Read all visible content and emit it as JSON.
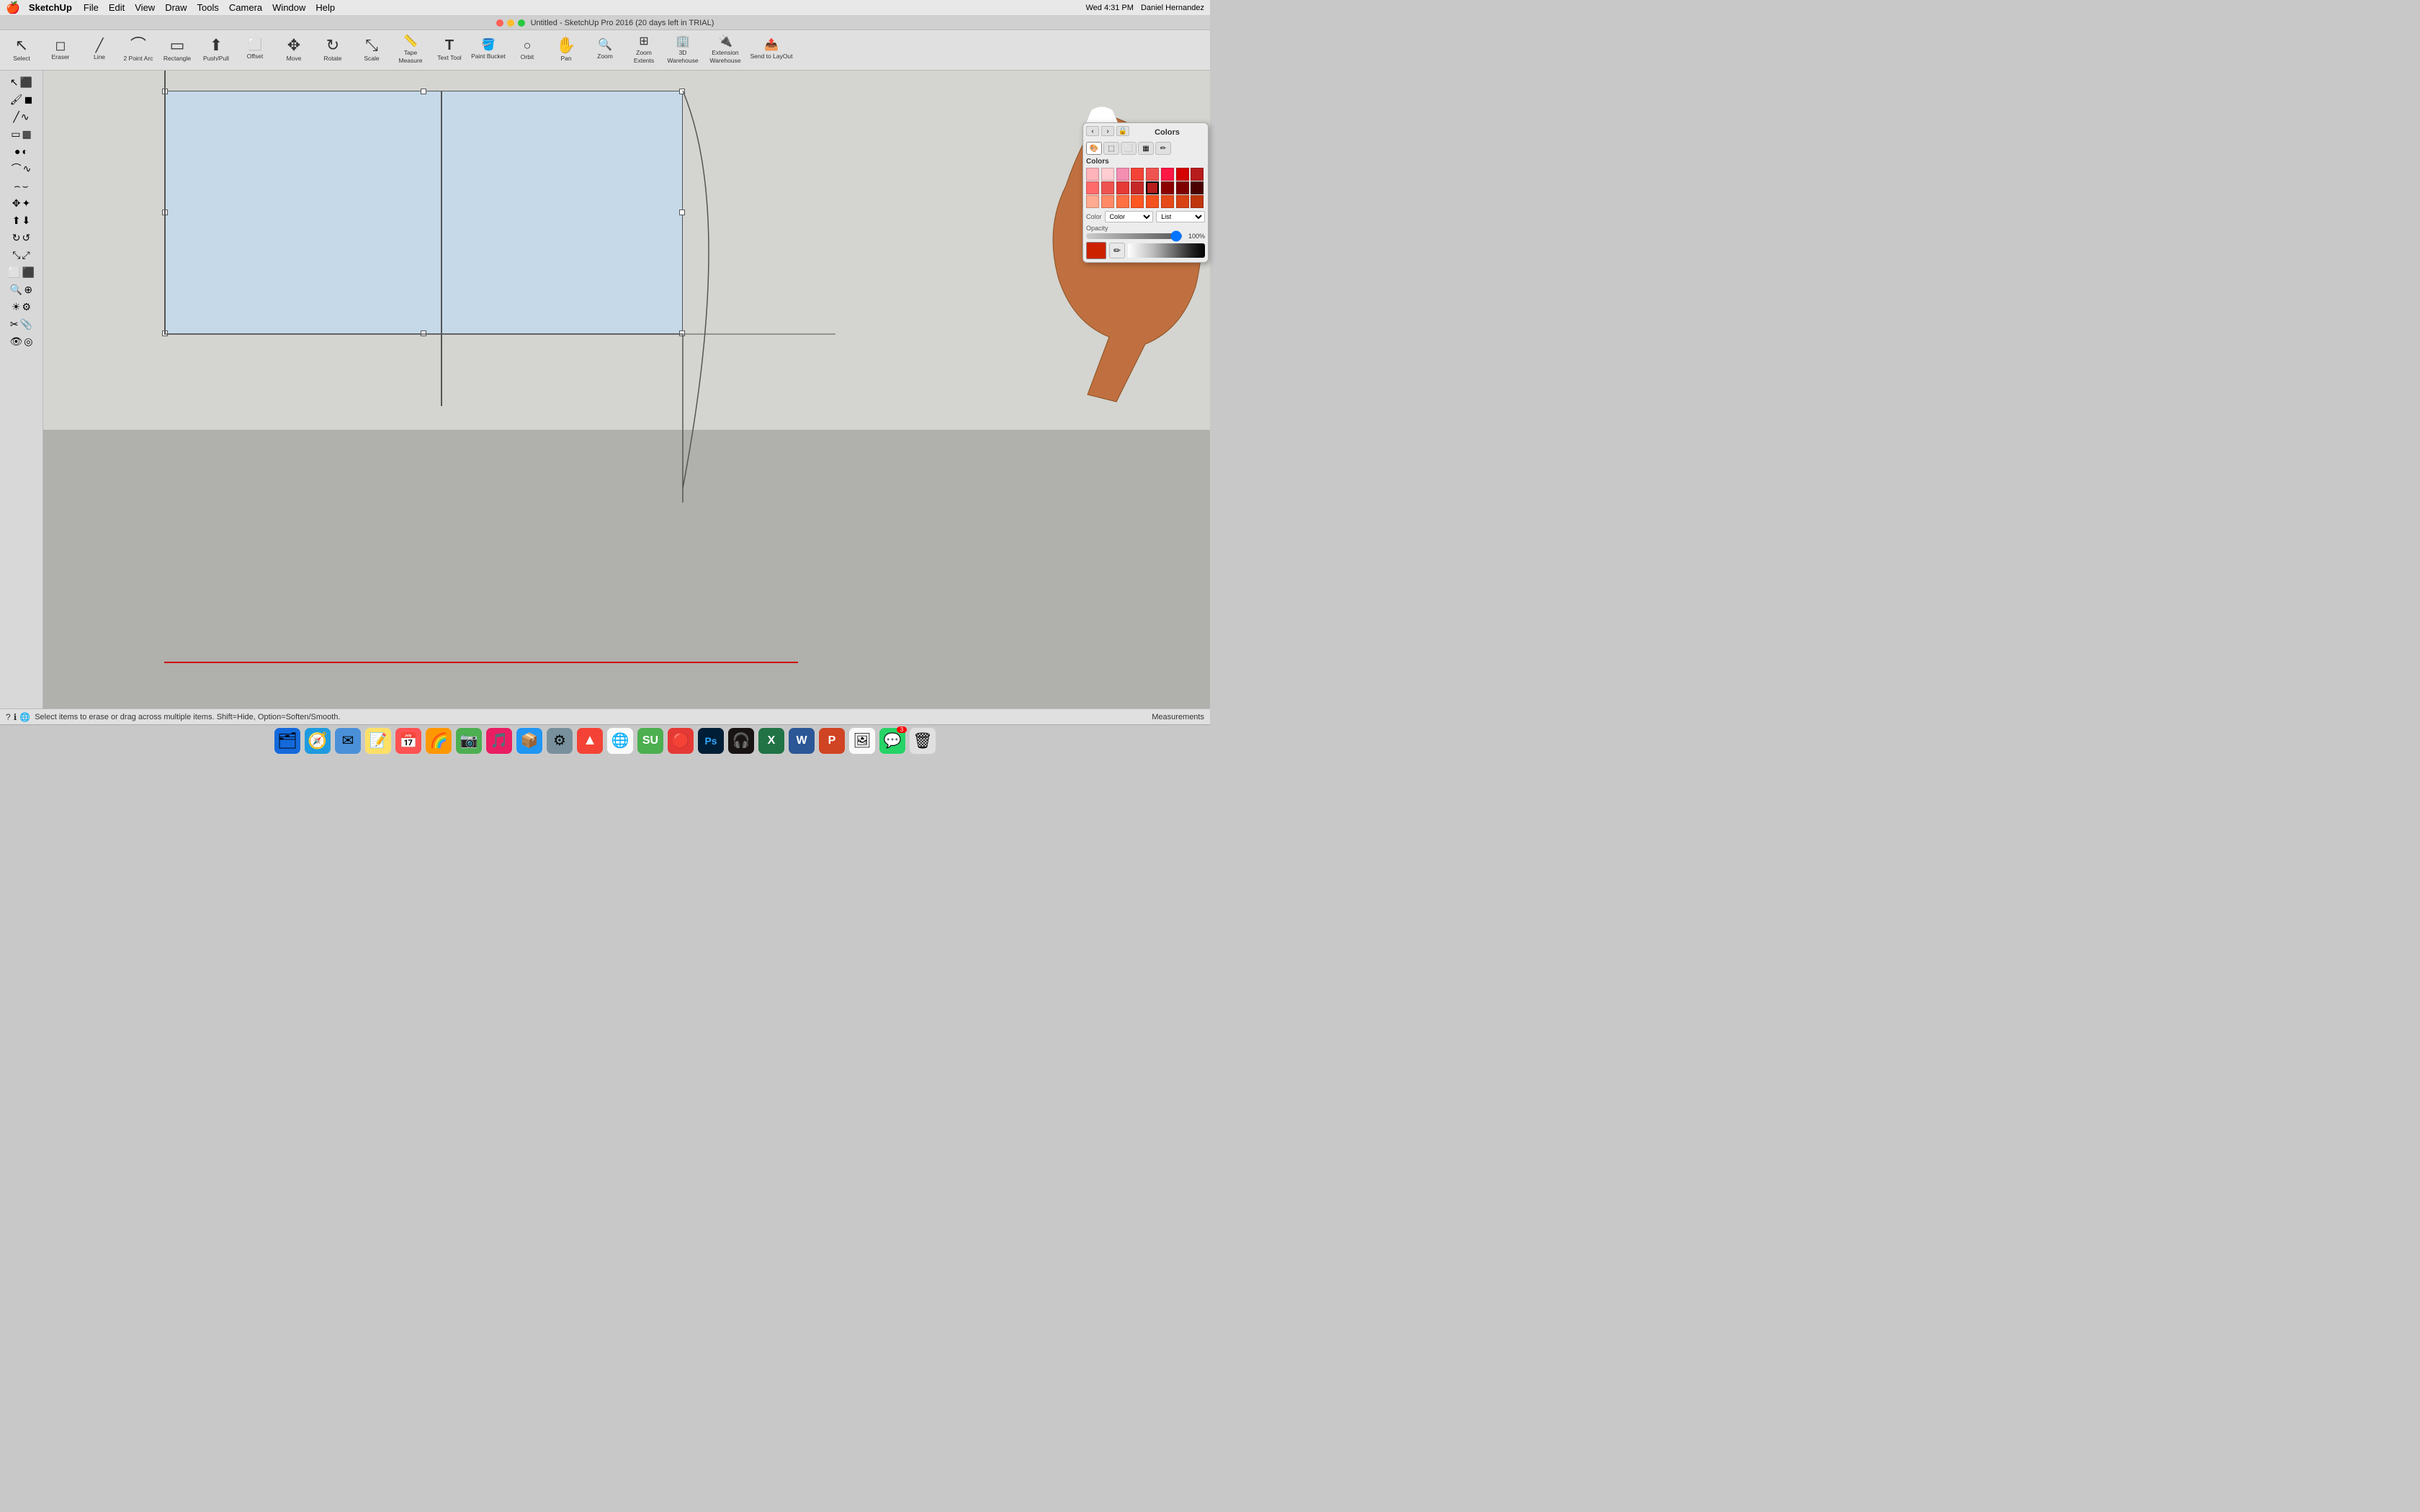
{
  "menubar": {
    "apple": "🍎",
    "app_name": "SketchUp",
    "menus": [
      "File",
      "Edit",
      "View",
      "Draw",
      "Tools",
      "Camera",
      "Window",
      "Help"
    ],
    "title": "Untitled - SketchUp Pro 2016 (20 days left in TRIAL)",
    "right_items": [
      "Wed 4:31 PM",
      "Daniel Hernandez"
    ]
  },
  "toolbar": {
    "tools": [
      {
        "id": "select",
        "icon": "↖",
        "label": "Select"
      },
      {
        "id": "eraser",
        "icon": "◻",
        "label": "Eraser"
      },
      {
        "id": "line",
        "icon": "/",
        "label": "Line"
      },
      {
        "id": "arc2pt",
        "icon": "⌒",
        "label": "2 Point Arc"
      },
      {
        "id": "rectangle",
        "icon": "▭",
        "label": "Rectangle"
      },
      {
        "id": "pushpull",
        "icon": "⬆",
        "label": "Push/Pull"
      },
      {
        "id": "offset",
        "icon": "⬜",
        "label": "Offset"
      },
      {
        "id": "move",
        "icon": "✥",
        "label": "Move"
      },
      {
        "id": "rotate",
        "icon": "↻",
        "label": "Rotate"
      },
      {
        "id": "scale",
        "icon": "⤡",
        "label": "Scale"
      },
      {
        "id": "tapemeasure",
        "icon": "📏",
        "label": "Tape Measure"
      },
      {
        "id": "texttool",
        "icon": "T",
        "label": "Text Tool"
      },
      {
        "id": "paintbucket",
        "icon": "🪣",
        "label": "Paint Bucket"
      },
      {
        "id": "orbit",
        "icon": "○",
        "label": "Orbit"
      },
      {
        "id": "pan",
        "icon": "✋",
        "label": "Pan"
      },
      {
        "id": "zoom",
        "icon": "🔍",
        "label": "Zoom"
      },
      {
        "id": "zoomextents",
        "icon": "⊞",
        "label": "Zoom Extents"
      },
      {
        "id": "warehouse3d",
        "icon": "🏢",
        "label": "3D Warehouse"
      },
      {
        "id": "extwarehouse",
        "icon": "🔌",
        "label": "Extension Warehouse"
      },
      {
        "id": "sendtolayout",
        "icon": "📤",
        "label": "Send to LayOut"
      }
    ]
  },
  "sidebar": {
    "tools": [
      {
        "id": "select1",
        "icon1": "↖",
        "icon2": "⬛"
      },
      {
        "id": "paint",
        "icon1": "🖌",
        "icon2": "◼"
      },
      {
        "id": "line1",
        "icon1": "/",
        "icon2": "〜"
      },
      {
        "id": "rect1",
        "icon1": "▭",
        "icon2": "▦"
      },
      {
        "id": "circle1",
        "icon1": "●",
        "icon2": "◐"
      },
      {
        "id": "arc1",
        "icon1": "⌒",
        "icon2": "∿"
      },
      {
        "id": "curve1",
        "icon1": "⌢",
        "icon2": "⌣"
      },
      {
        "id": "move1",
        "icon1": "✥",
        "icon2": "✦"
      },
      {
        "id": "push1",
        "icon1": "⬆",
        "icon2": "⬇"
      },
      {
        "id": "rotate1",
        "icon1": "↻",
        "icon2": "↺"
      },
      {
        "id": "scale1",
        "icon1": "⤡",
        "icon2": "⤢"
      },
      {
        "id": "offset1",
        "icon1": "⬜",
        "icon2": "⬛"
      },
      {
        "id": "search1",
        "icon1": "🔍",
        "icon2": "⊕"
      },
      {
        "id": "walk1",
        "icon1": "☀",
        "icon2": "⚙"
      },
      {
        "id": "section1",
        "icon1": "✂",
        "icon2": "📎"
      },
      {
        "id": "eye1",
        "icon1": "👁",
        "icon2": "◎"
      }
    ]
  },
  "status": {
    "icons": [
      "?",
      "ℹ",
      "🌐"
    ],
    "message": "Select items to erase or drag across multiple items. Shift=Hide, Option=Soften/Smooth.",
    "measurements": "Measurements"
  },
  "colors_panel": {
    "title": "Colors",
    "tabs": [
      "🎨",
      "⬚",
      "⬜",
      "▦",
      "◻"
    ],
    "section_label": "Colors",
    "color_label": "Color",
    "list_label": "List",
    "opacity_label": "Opacity",
    "opacity_value": "100%",
    "selected_color": "#cc2200",
    "colors_grid": [
      "#ffb3ba",
      "#ffcdd2",
      "#f48fb1",
      "#f44336",
      "#e91e63",
      "#ff1744",
      "#d50000",
      "#b71c1c",
      "#ff6b6b",
      "#ef5350",
      "#e53935",
      "#c62828",
      "#b71c1c",
      "#8b0000",
      "#7f0000",
      "#4a0000",
      "#ffab91",
      "#ff8a65",
      "#ff7043",
      "#ff5722",
      "#f4511e",
      "#e64a19",
      "#d84315",
      "#bf360c"
    ]
  },
  "dock": {
    "items": [
      {
        "id": "finder",
        "icon": "🗂",
        "label": "Finder"
      },
      {
        "id": "safari",
        "icon": "🧭",
        "label": "Safari"
      },
      {
        "id": "mail",
        "icon": "✉",
        "label": "Mail"
      },
      {
        "id": "notes",
        "icon": "📝",
        "label": "Notes"
      },
      {
        "id": "calendar",
        "icon": "📅",
        "label": "Calendar"
      },
      {
        "id": "photos",
        "icon": "🖼",
        "label": "Photos"
      },
      {
        "id": "faceTime",
        "icon": "📷",
        "label": "FaceTime"
      },
      {
        "id": "music",
        "icon": "🎵",
        "label": "Music"
      },
      {
        "id": "appstore",
        "icon": "📦",
        "label": "App Store"
      },
      {
        "id": "systemprefs",
        "icon": "⚙",
        "label": "System Preferences"
      },
      {
        "id": "artstudio",
        "icon": "🔺",
        "label": "Art Studio"
      },
      {
        "id": "chrome",
        "icon": "🌐",
        "label": "Chrome"
      },
      {
        "id": "sketchup2",
        "icon": "🏗",
        "label": "SketchUp"
      },
      {
        "id": "artrage",
        "icon": "🔴",
        "label": "ArtRage"
      },
      {
        "id": "photoshop",
        "icon": "Ps",
        "label": "Photoshop"
      },
      {
        "id": "spotify",
        "icon": "🎧",
        "label": "Spotify"
      },
      {
        "id": "excel",
        "icon": "X",
        "label": "Excel"
      },
      {
        "id": "word",
        "icon": "W",
        "label": "Word"
      },
      {
        "id": "powerpoint",
        "icon": "P",
        "label": "PowerPoint"
      },
      {
        "id": "photos2",
        "icon": "🖼",
        "label": "Photos"
      },
      {
        "id": "whatsapp",
        "icon": "💬",
        "label": "WhatsApp",
        "badge": "3"
      },
      {
        "id": "trash",
        "icon": "🗑",
        "label": "Trash"
      }
    ]
  }
}
